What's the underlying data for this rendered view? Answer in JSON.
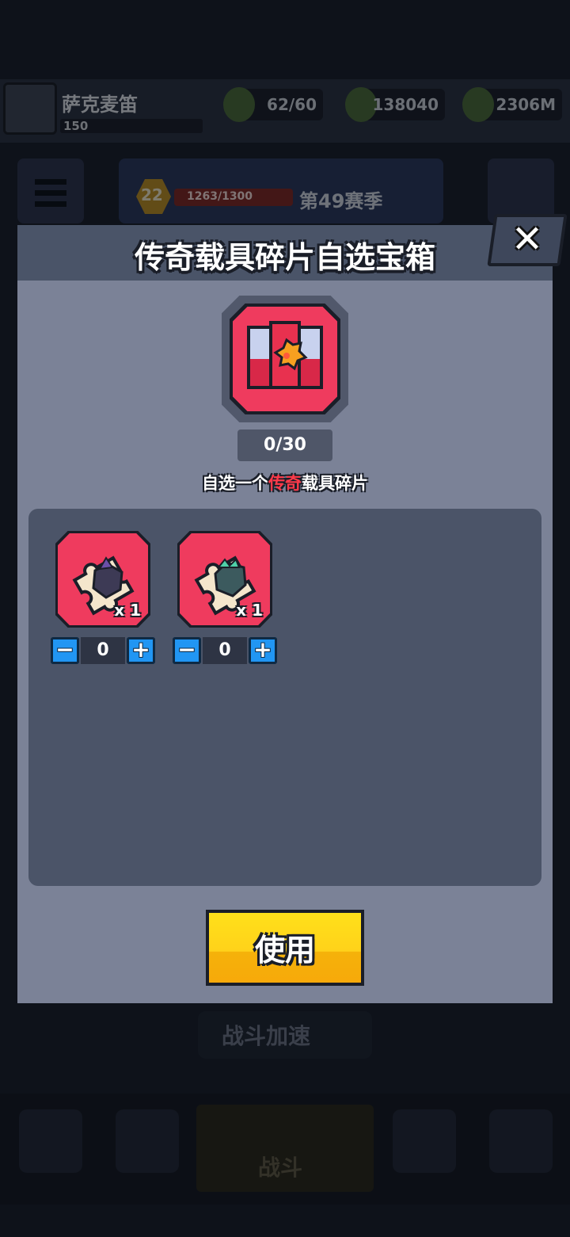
{
  "background": {
    "player_name": "萨克麦笛",
    "player_level": "150",
    "resources": [
      {
        "name": "energy",
        "value": "62/60"
      },
      {
        "name": "gold",
        "value": "138040"
      },
      {
        "name": "gems",
        "value": "2306M"
      }
    ],
    "season_level": "22",
    "season_progress": "1263/1300",
    "season_label": "第49赛季",
    "speed_label": "战斗加速",
    "battle_label": "战斗"
  },
  "modal": {
    "title": "传奇载具碎片自选宝箱",
    "close_label": "✕",
    "selection_count": "0/30",
    "description_prefix": "自选一个",
    "description_highlight": "传奇",
    "description_suffix": "载具碎片",
    "items": [
      {
        "quantity_label": "x 1",
        "icon": "dark-vehicle-puzzle-piece-icon",
        "selected": "0"
      },
      {
        "quantity_label": "x 1",
        "icon": "teal-vehicle-puzzle-piece-icon",
        "selected": "0"
      }
    ],
    "stepper_minus": "−",
    "stepper_plus": "+",
    "use_label": "使用"
  },
  "colors": {
    "modal_bg": "#7b8297",
    "header_bg": "#4a5468",
    "item_red": "#ef3b5e",
    "highlight_red": "#ff3a4a",
    "stepper_blue": "#2196f3",
    "use_yellow": "#ffd21a"
  }
}
